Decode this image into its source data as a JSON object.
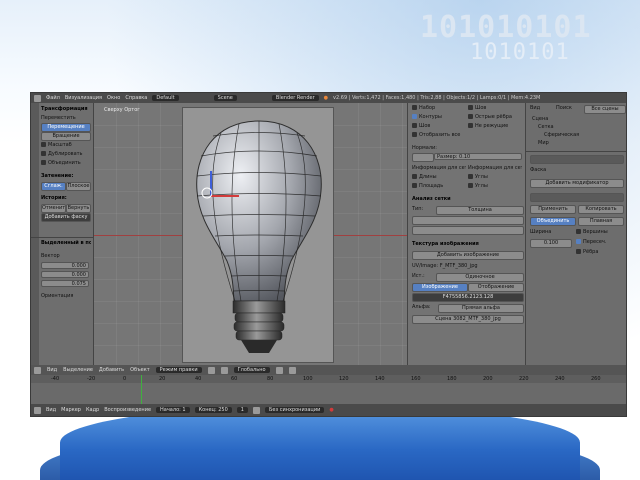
{
  "slide": {
    "binary_top": "101010101",
    "binary_bottom": "1010101"
  },
  "app": {
    "topbar": {
      "menus": [
        "Файл",
        "Визуализация",
        "Окно",
        "Справка"
      ],
      "layout": "Default",
      "scene": "Scene",
      "renderer": "Blender Render",
      "info": "v2.69 | Verts:1,472 | Faces:1,480 | Tris:2,88 | Objects:1/2 | Lamps:0/1 | Mem:4.23M"
    },
    "toolshelf": {
      "section_transform": "Трансформация",
      "move": "Переместить",
      "rotate": "Вращать",
      "scale": "Масштаб",
      "tools": [
        "Перемещение",
        "Вращение",
        "Масштаб"
      ],
      "edit_section": "Редактирование",
      "duplicate": "Дублировать",
      "join": "Объединить",
      "shading_label": "Затенение:",
      "smooth": "Сглаж.",
      "flat": "Плоское",
      "history_label": "История:",
      "undo": "Отменить",
      "redo": "Вернуть",
      "add_bevel": "Добавить фаску",
      "last_op": "Выделенный в порядке",
      "vector_label": "Вектор",
      "x_value": "0.000",
      "y_value": "0.000",
      "z_value": "0.075",
      "orientation_label": "Ориентация"
    },
    "viewport": {
      "label": "Сверху Ортог"
    },
    "properties": {
      "checks_left": [
        "Набор",
        "Контуры",
        "Шов",
        "Отобразить все"
      ],
      "checks_right": [
        "Шов",
        "Острые рёбра",
        "Не режущие"
      ],
      "normals_label": "Нормали:",
      "size_label": "Размер:",
      "size_value": "0.10",
      "mesh_display_label": "Информация для сетки:",
      "mesh_display_right": "Информация для сетки:",
      "len_label": "Длины",
      "angle_label": "Углы",
      "area_label": "Площадь",
      "area_label2": "Углы",
      "analysis_header": "Анализ сетки",
      "type_label": "Тип:",
      "type_value": "Толщина",
      "texture_header": "Текстура изображения",
      "add_image": "Добавить изображение",
      "uv_label": "UV/Image: F_MTF_380_jpg",
      "source_label": "Ист.:",
      "source_value": "Одиночное",
      "image_tab": "Изображение",
      "mapping_tab": "Отображение",
      "file_value": "F4755856.2123.128",
      "alpha_label": "Альфа:",
      "alpha_value": "Прямая альфа",
      "file_path": "Сцена 3082_MTF_380_jpg"
    },
    "outliner": {
      "tabs": [
        "Вид",
        "Поиск",
        "Все сцены"
      ],
      "tree": [
        "Сцена",
        "Сетка",
        "Сферическая",
        "Мир"
      ],
      "bevel_label": "Фаска",
      "search_value": "Добавить модификатор",
      "apply": "Применить",
      "copy": "Копировать",
      "mode_label": "Объединить",
      "mode_value": "Плавная",
      "offset_label": "Ширина",
      "offset_value": "0.100",
      "opt_a": "Вершины",
      "opt_b": "Пересеч.",
      "opt_c": "Рёбра"
    },
    "bottombar": {
      "view": "Вид",
      "select": "Выделение",
      "add": "Добавить",
      "object": "Объект",
      "mode": "Режим правки",
      "global": "Глобально"
    },
    "timeline": {
      "ticks": [
        "-40",
        "-20",
        "0",
        "20",
        "40",
        "60",
        "80",
        "100",
        "120",
        "140",
        "160",
        "180",
        "200",
        "220",
        "240",
        "260"
      ],
      "start_label": "Начало:",
      "start_value": "1",
      "end_label": "Конец:",
      "end_value": "250",
      "frame_value": "1",
      "status_items": [
        "Вид",
        "Маркер",
        "Кадр",
        "Воспроизведение"
      ],
      "no_sync": "Без синхронизации"
    }
  }
}
